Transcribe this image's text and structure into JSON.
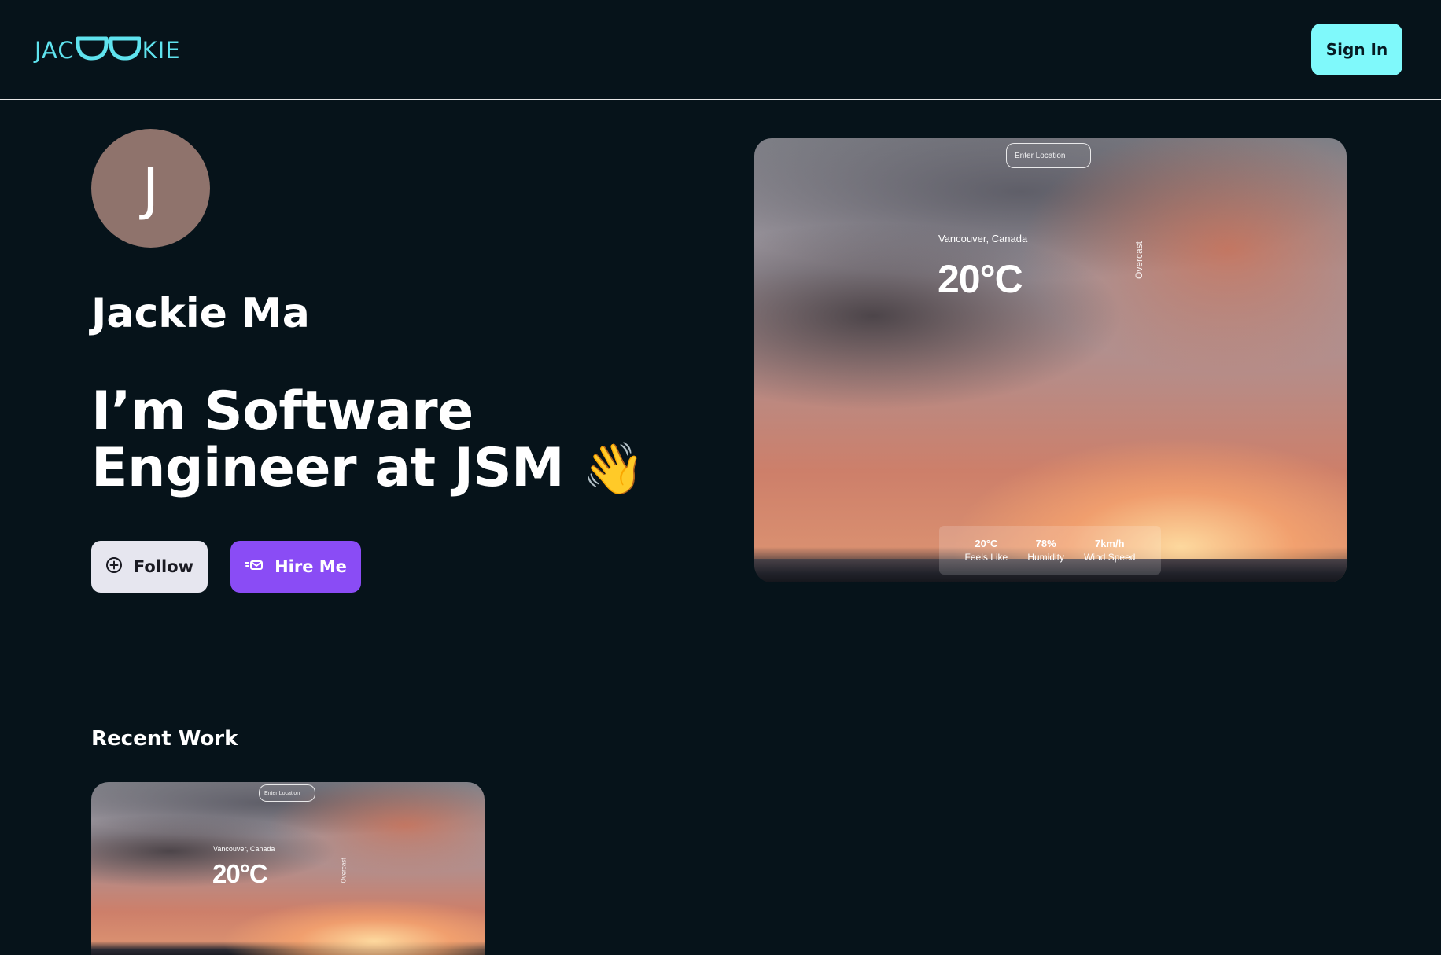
{
  "header": {
    "logo_left": "JAC",
    "logo_right": "KIE",
    "signin_label": "Sign In"
  },
  "profile": {
    "avatar_initial": "J",
    "name": "Jackie Ma",
    "headline": "I’m Software Engineer at JSM",
    "wave": "👋",
    "follow_label": "Follow",
    "hire_label": "Hire Me"
  },
  "preview": {
    "location_placeholder": "Enter Location",
    "city": "Vancouver, Canada",
    "temperature": "20°C",
    "condition": "Overcast",
    "stats": [
      {
        "value": "20°C",
        "label": "Feels Like"
      },
      {
        "value": "78%",
        "label": "Humidity"
      },
      {
        "value": "7km/h",
        "label": "Wind Speed"
      }
    ]
  },
  "recent_work": {
    "title": "Recent Work"
  },
  "colors": {
    "background": "#06131a",
    "logo": "#5fe3ee",
    "signin_bg": "#7ff9fb",
    "hire_bg": "#8a4cf5",
    "follow_bg": "#e6e6ef",
    "avatar_bg": "#8f736c"
  },
  "icons": {
    "logo": "glasses-icon",
    "follow": "plus-circle-icon",
    "hire": "mail-send-icon"
  }
}
